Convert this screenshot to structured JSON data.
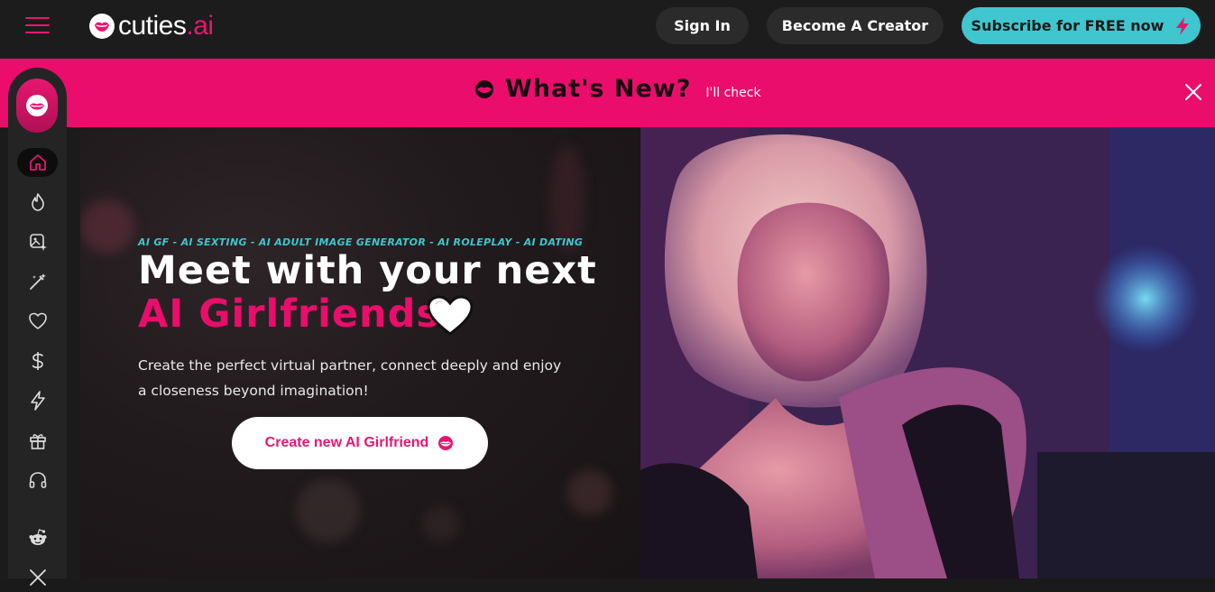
{
  "header": {
    "logo_text": "cuties",
    "logo_suffix": ".ai",
    "signin_label": "Sign In",
    "creator_label": "Become A Creator",
    "subscribe_label": "Subscribe for FREE now"
  },
  "banner": {
    "title": "What's New?",
    "link_label": "I'll check"
  },
  "sidebar": {
    "items": [
      {
        "icon": "home-icon",
        "active": true
      },
      {
        "icon": "fire-icon",
        "active": false
      },
      {
        "icon": "image-sparkle-icon",
        "active": false
      },
      {
        "icon": "magic-wand-icon",
        "active": false
      },
      {
        "icon": "heart-icon",
        "active": false
      },
      {
        "icon": "dollar-icon",
        "active": false
      },
      {
        "icon": "lightning-icon",
        "active": false
      },
      {
        "icon": "gift-icon",
        "active": false
      },
      {
        "icon": "headphones-icon",
        "active": false
      },
      {
        "icon": "reddit-icon",
        "active": false
      },
      {
        "icon": "x-twitter-icon",
        "active": false
      }
    ]
  },
  "hero": {
    "tags": "AI GF - AI SEXTING - AI ADULT IMAGE GENERATOR - AI ROLEPLAY - AI DATING",
    "headline_line1": "Meet with your next",
    "headline_line2": "AI Girlfriends",
    "subtext": "Create the perfect virtual partner, connect deeply and enjoy a closeness beyond imagination!",
    "cta_label": "Create new AI Girlfriend"
  },
  "colors": {
    "brand_pink": "#ea0d6b",
    "accent_cyan": "#3fc6cf",
    "topbar_bg": "#1c1c1c"
  }
}
